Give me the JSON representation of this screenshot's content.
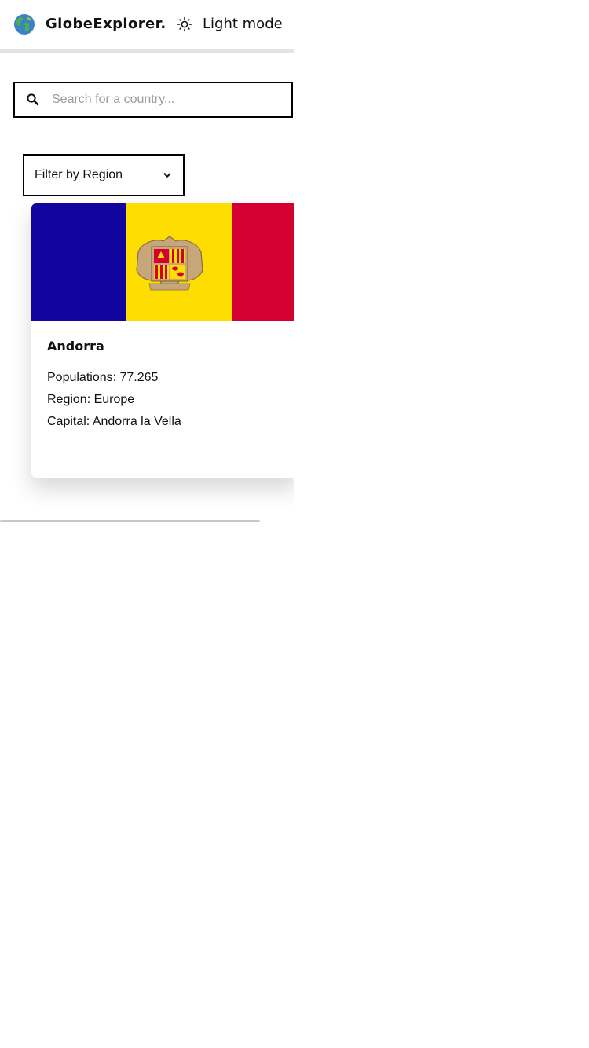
{
  "header": {
    "app_title": "GlobeExplorer.",
    "logo_icon": "globe-icon",
    "mode_toggle": {
      "label": "Light mode",
      "icon": "sun-icon"
    }
  },
  "search": {
    "placeholder": "Search for a country...",
    "value": "",
    "icon": "search-icon"
  },
  "filter": {
    "label": "Filter by Region",
    "icon": "chevron-down-icon"
  },
  "countries": [
    {
      "name": "Andorra",
      "population": "Populations: 77.265",
      "region": "Region: Europe",
      "capital": "Capital: Andorra la Vella",
      "flag_colors": [
        "#10069f",
        "#fedd00",
        "#d50032"
      ]
    }
  ],
  "colors": {
    "border": "#000000",
    "text": "#111111",
    "placeholder": "#999ba3",
    "background": "#ffffff"
  }
}
